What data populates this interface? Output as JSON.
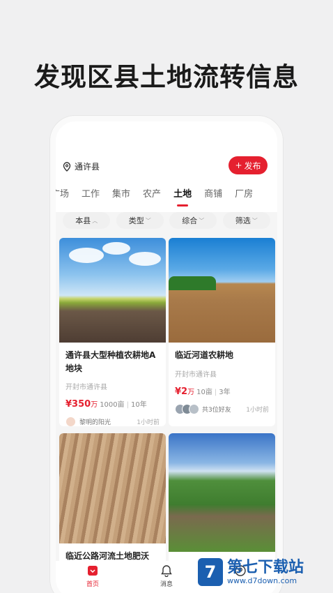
{
  "headline": "发现区县土地流转信息",
  "app": {
    "location": "通许县",
    "publish_label": "发布",
    "tabs": [
      "广场",
      "工作",
      "集市",
      "农产",
      "土地",
      "商铺",
      "厂房"
    ],
    "active_tab": "土地",
    "filters": [
      "本县",
      "类型",
      "综合",
      "筛选"
    ],
    "cards": [
      {
        "title": "通许县大型种植农耕地A地块",
        "region": "开封市通许县",
        "price": "¥350",
        "price_unit": "万",
        "area": "1000亩",
        "years": "10年",
        "user": "黎明的阳光",
        "time": "1小时前"
      },
      {
        "title": "临近河道农耕地",
        "region": "开封市通许县",
        "price": "¥2",
        "price_unit": "万",
        "area": "10亩",
        "years": "3年",
        "user": "共3位好友",
        "time": "1小时前"
      },
      {
        "title": "临近公路河流土地肥沃"
      },
      {
        "title": ""
      }
    ],
    "bottom_nav": [
      {
        "label": "首页",
        "icon": "home-icon",
        "active": true
      },
      {
        "label": "消息",
        "icon": "bell-icon",
        "active": false
      },
      {
        "label": "",
        "icon": "profile-icon",
        "active": false
      }
    ]
  },
  "watermark": {
    "logo_char": "7",
    "name": "第七下载站",
    "url": "www.d7down.com"
  },
  "colors": {
    "accent": "#e5202f",
    "watermark": "#1b5fb0"
  }
}
